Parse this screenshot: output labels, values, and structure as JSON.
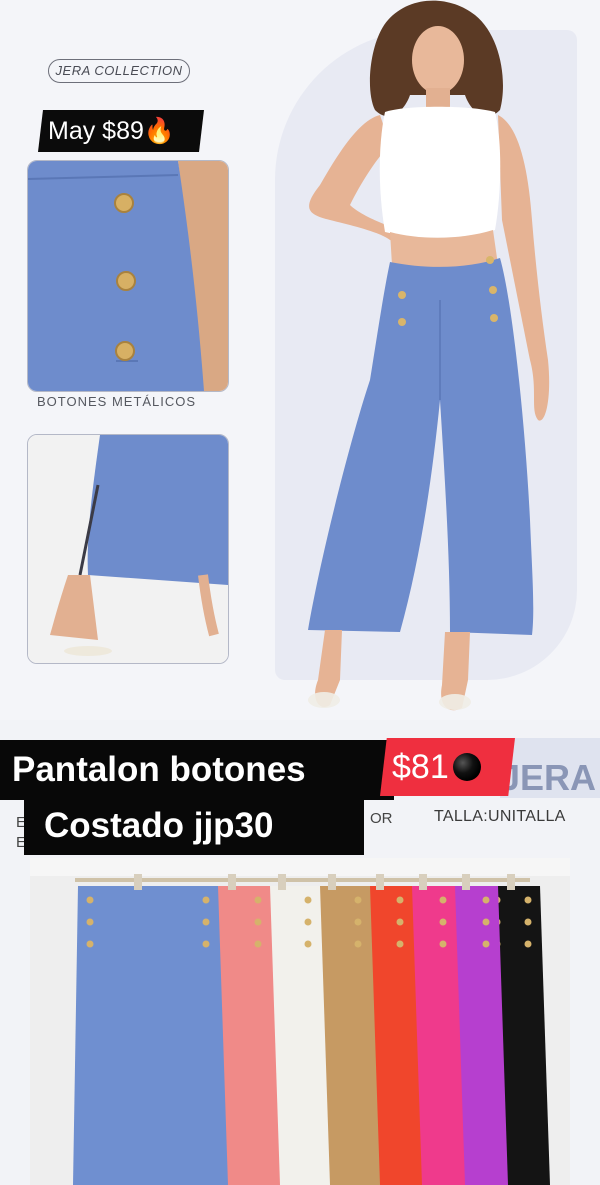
{
  "brand": {
    "collection_label": "JERA COLLECTION",
    "logo_text": "JERA"
  },
  "pricing": {
    "wholesale": "May $89",
    "wholesale_emoji": "🔥",
    "retail": "$81"
  },
  "details": {
    "metal_buttons_label": "BOTONES METÁLICOS"
  },
  "product": {
    "title_line1": "Pantalon botones",
    "title_line2": "Costado jjp30",
    "size": "TALLA:UNITALLA"
  },
  "stray_text": {
    "left_e": "E",
    "left_e2": "E",
    "or": "OR"
  },
  "colors": {
    "accent_red": "#ef2f3f",
    "pants_swatches": [
      "#6f8fd0",
      "#f08a88",
      "#f2f1ec",
      "#c69a63",
      "#f0462c",
      "#ef3a8c",
      "#b63fcf",
      "#141414"
    ]
  }
}
